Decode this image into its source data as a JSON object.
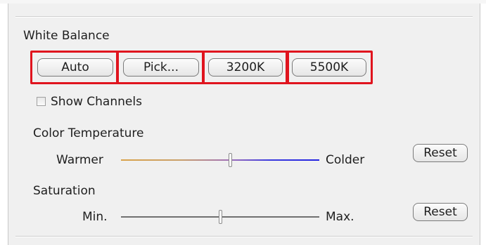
{
  "white_balance": {
    "label": "White Balance",
    "buttons": [
      "Auto",
      "Pick...",
      "3200K",
      "5500K"
    ]
  },
  "show_channels": {
    "label": "Show Channels",
    "checked": false
  },
  "color_temperature": {
    "label": "Color Temperature",
    "min_label": "Warmer",
    "max_label": "Colder",
    "value": 0.55,
    "reset_label": "Reset"
  },
  "saturation": {
    "label": "Saturation",
    "min_label": "Min.",
    "max_label": "Max.",
    "value": 0.5,
    "reset_label": "Reset"
  },
  "colors": {
    "highlight": "#e0141e",
    "panel": "#f0f0f0"
  }
}
